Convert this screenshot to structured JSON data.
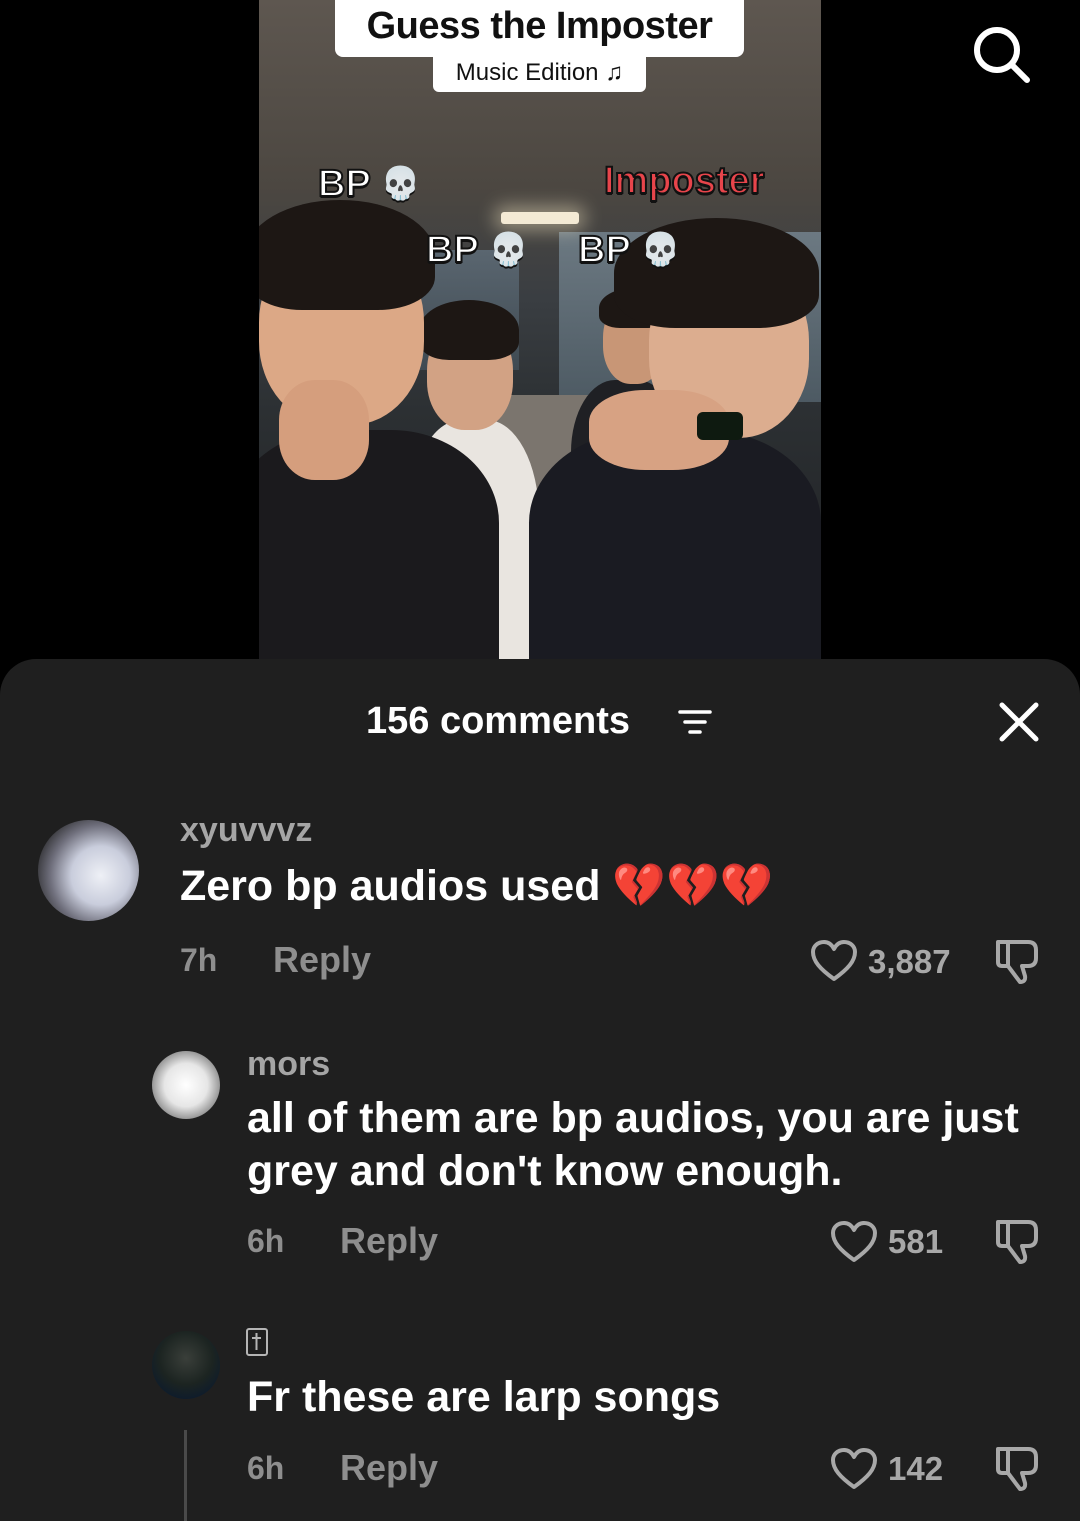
{
  "video": {
    "title": "Guess the Imposter",
    "subtitle": "Music Edition ♫",
    "labels": [
      {
        "text": "BP",
        "emoji": "💀"
      },
      {
        "text": "BP",
        "emoji": "💀"
      },
      {
        "text": "BP",
        "emoji": "💀"
      },
      {
        "text": "Imposter"
      }
    ],
    "search_icon": "search-icon"
  },
  "comments_sheet": {
    "count_label": "156 comments",
    "filter_icon": "filter-icon",
    "close_icon": "close-icon",
    "comments": [
      {
        "username": "xyuvvvz",
        "text": "Zero bp audios used 💔💔💔",
        "time": "7h",
        "reply_label": "Reply",
        "likes": "3,887"
      },
      {
        "username": "mors",
        "text": "all of them are bp audios, you are just grey and don't know enough.",
        "time": "6h",
        "reply_label": "Reply",
        "likes": "581"
      },
      {
        "username": "",
        "text": "Fr these are larp songs",
        "time": "6h",
        "reply_label": "Reply",
        "likes": "142"
      }
    ]
  }
}
